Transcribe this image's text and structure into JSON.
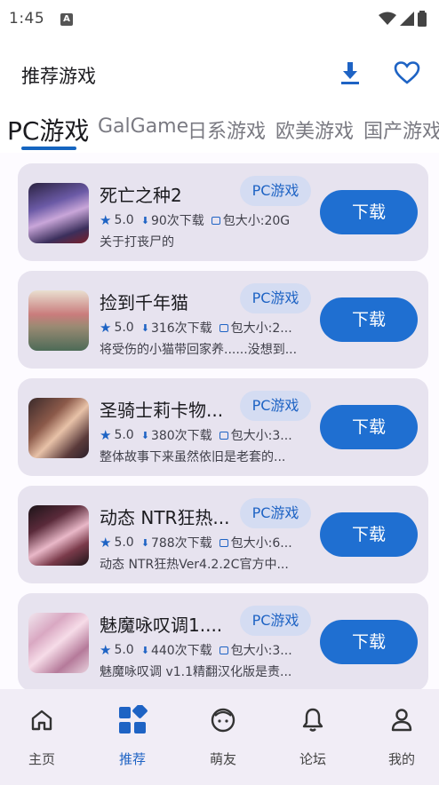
{
  "status_bar": {
    "time": "1:45",
    "notif": "A"
  },
  "header": {
    "title": "推荐游戏",
    "download_icon": "download-icon",
    "favorite_icon": "heart-icon"
  },
  "tabs": [
    {
      "label": "PC游戏",
      "active": true
    },
    {
      "label": "GalGame",
      "active": false
    },
    {
      "label": "日系游戏",
      "active": false
    },
    {
      "label": "欧美游戏",
      "active": false
    },
    {
      "label": "国产游戏",
      "active": false
    }
  ],
  "games": [
    {
      "name": "死亡之种2",
      "tag": "PC游戏",
      "rating": "5.0",
      "downloads": "90次下载",
      "size": "包大小:20G",
      "desc": "关于打丧尸的",
      "button": "下载"
    },
    {
      "name": "捡到千年猫",
      "tag": "PC游戏",
      "rating": "5.0",
      "downloads": "316次下载",
      "size": "包大小:2...",
      "desc": "将受伤的小猫带回家养......没想到...",
      "button": "下载"
    },
    {
      "name": "圣骑士莉卡物...",
      "tag": "PC游戏",
      "rating": "5.0",
      "downloads": "380次下载",
      "size": "包大小:3...",
      "desc": "整体故事下来虽然依旧是老套的...",
      "button": "下载"
    },
    {
      "name": "动态 NTR狂热...",
      "tag": "PC游戏",
      "rating": "5.0",
      "downloads": "788次下载",
      "size": "包大小:6...",
      "desc": "动态 NTR狂热Ver4.2.2C官方中...",
      "button": "下载"
    },
    {
      "name": "魅魔咏叹调1....",
      "tag": "PC游戏",
      "rating": "5.0",
      "downloads": "440次下载",
      "size": "包大小:3...",
      "desc": "魅魔咏叹调 v1.1精翻汉化版是责...",
      "button": "下载"
    }
  ],
  "bottom_nav": [
    {
      "label": "主页",
      "icon": "home-icon",
      "active": false
    },
    {
      "label": "推荐",
      "icon": "grid-icon",
      "active": true
    },
    {
      "label": "萌友",
      "icon": "face-icon",
      "active": false
    },
    {
      "label": "论坛",
      "icon": "bell-icon",
      "active": false
    },
    {
      "label": "我的",
      "icon": "person-icon",
      "active": false
    }
  ],
  "colors": {
    "accent": "#1f6fd1",
    "card_bg": "#e7e3ef",
    "chip_bg": "#d4dcf2",
    "nav_bg": "#f1edf6"
  }
}
